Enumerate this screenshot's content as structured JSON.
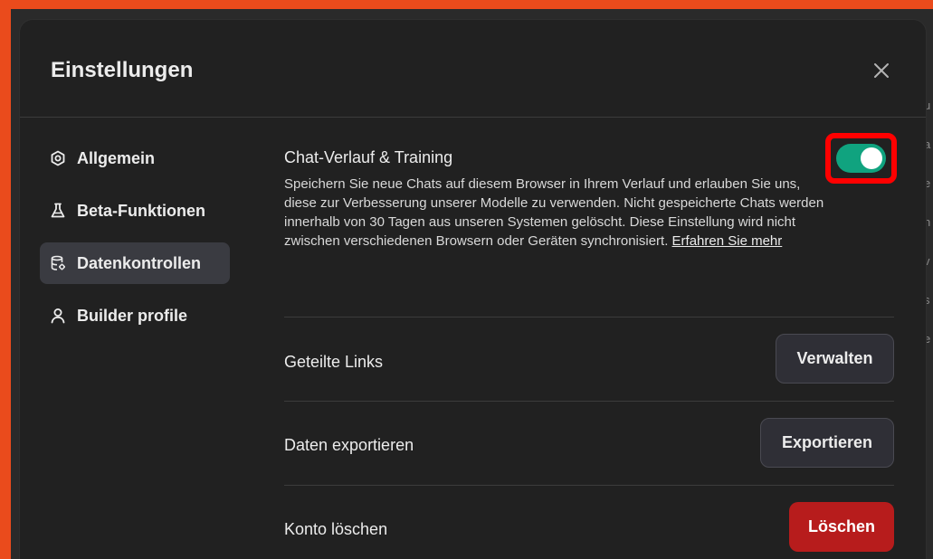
{
  "modal": {
    "title": "Einstellungen",
    "close_icon": "close-icon"
  },
  "sidebar": {
    "items": [
      {
        "label": "Allgemein",
        "icon": "gear-icon",
        "active": false
      },
      {
        "label": "Beta-Funktionen",
        "icon": "flask-icon",
        "active": false
      },
      {
        "label": "Datenkontrollen",
        "icon": "database-icon",
        "active": true
      },
      {
        "label": "Builder profile",
        "icon": "person-icon",
        "active": false
      }
    ]
  },
  "content": {
    "history": {
      "title": "Chat-Verlauf & Training",
      "description": "Speichern Sie neue Chats auf diesem Browser in Ihrem Verlauf und erlauben Sie uns, diese zur Verbesserung unserer Modelle zu verwenden. Nicht gespeicherte Chats werden innerhalb von 30 Tagen aus unseren Systemen gelöscht. Diese Einstellung wird nicht zwischen verschiedenen Browsern oder Geräten synchronisiert.",
      "link": "Erfahren Sie mehr",
      "toggle_on": true
    },
    "shared_links": {
      "label": "Geteilte Links",
      "button": "Verwalten"
    },
    "export": {
      "label": "Daten exportieren",
      "button": "Exportieren"
    },
    "delete": {
      "label": "Konto löschen",
      "button": "Löschen"
    }
  },
  "colors": {
    "accent_green": "#10a37f",
    "danger_red": "#b71c1c",
    "highlight_red": "#ff0000",
    "frame_orange": "#ea4b1c"
  }
}
